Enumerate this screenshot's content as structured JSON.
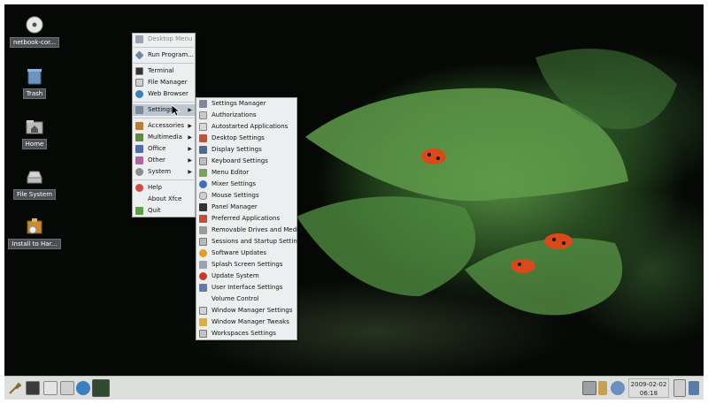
{
  "desktop_icons": [
    {
      "label": "netbook-cor...",
      "icon": "cd-drive-icon"
    },
    {
      "label": "Trash",
      "icon": "trash-icon"
    },
    {
      "label": "Home",
      "icon": "home-folder-icon"
    },
    {
      "label": "File System",
      "icon": "hard-drive-icon"
    },
    {
      "label": "Install to Har...",
      "icon": "installer-icon"
    }
  ],
  "main_menu": {
    "header": "Desktop Menu",
    "items": [
      {
        "label": "Run Program...",
        "icon": "run-icon"
      },
      {
        "label": "Terminal",
        "icon": "terminal-icon"
      },
      {
        "label": "File Manager",
        "icon": "file-manager-icon"
      },
      {
        "label": "Web Browser",
        "icon": "globe-icon"
      },
      {
        "label": "Settings",
        "icon": "settings-icon",
        "submenu": true,
        "highlighted": true
      },
      {
        "label": "Accessories",
        "icon": "accessories-icon",
        "submenu": true
      },
      {
        "label": "Multimedia",
        "icon": "multimedia-icon",
        "submenu": true
      },
      {
        "label": "Office",
        "icon": "office-icon",
        "submenu": true
      },
      {
        "label": "Other",
        "icon": "other-icon",
        "submenu": true
      },
      {
        "label": "System",
        "icon": "system-icon",
        "submenu": true
      },
      {
        "label": "Help",
        "icon": "help-icon"
      },
      {
        "label": "About Xfce",
        "icon": "info-icon"
      },
      {
        "label": "Quit",
        "icon": "quit-icon"
      }
    ]
  },
  "settings_menu": {
    "items": [
      "Settings Manager",
      "Authorizations",
      "Autostarted Applications",
      "Desktop Settings",
      "Display Settings",
      "Keyboard Settings",
      "Menu Editor",
      "Mixer Settings",
      "Mouse Settings",
      "Panel Manager",
      "Preferred Applications",
      "Removable Drives and Media",
      "Sessions and Startup Settings",
      "Software Updates",
      "Splash Screen Settings",
      "Update System",
      "User Interface Settings",
      "Volume Control",
      "Window Manager Settings",
      "Window Manager Tweaks",
      "Workspaces Settings"
    ]
  },
  "panel": {
    "clock_date": "2009-02-02",
    "clock_time": "06:18"
  },
  "colors": {
    "menu_bg": "#eceeef",
    "menu_highlight": "#bcc7d2",
    "panel_bg": "#dcdfdc",
    "desktop_label_bg": "#4c5054"
  }
}
